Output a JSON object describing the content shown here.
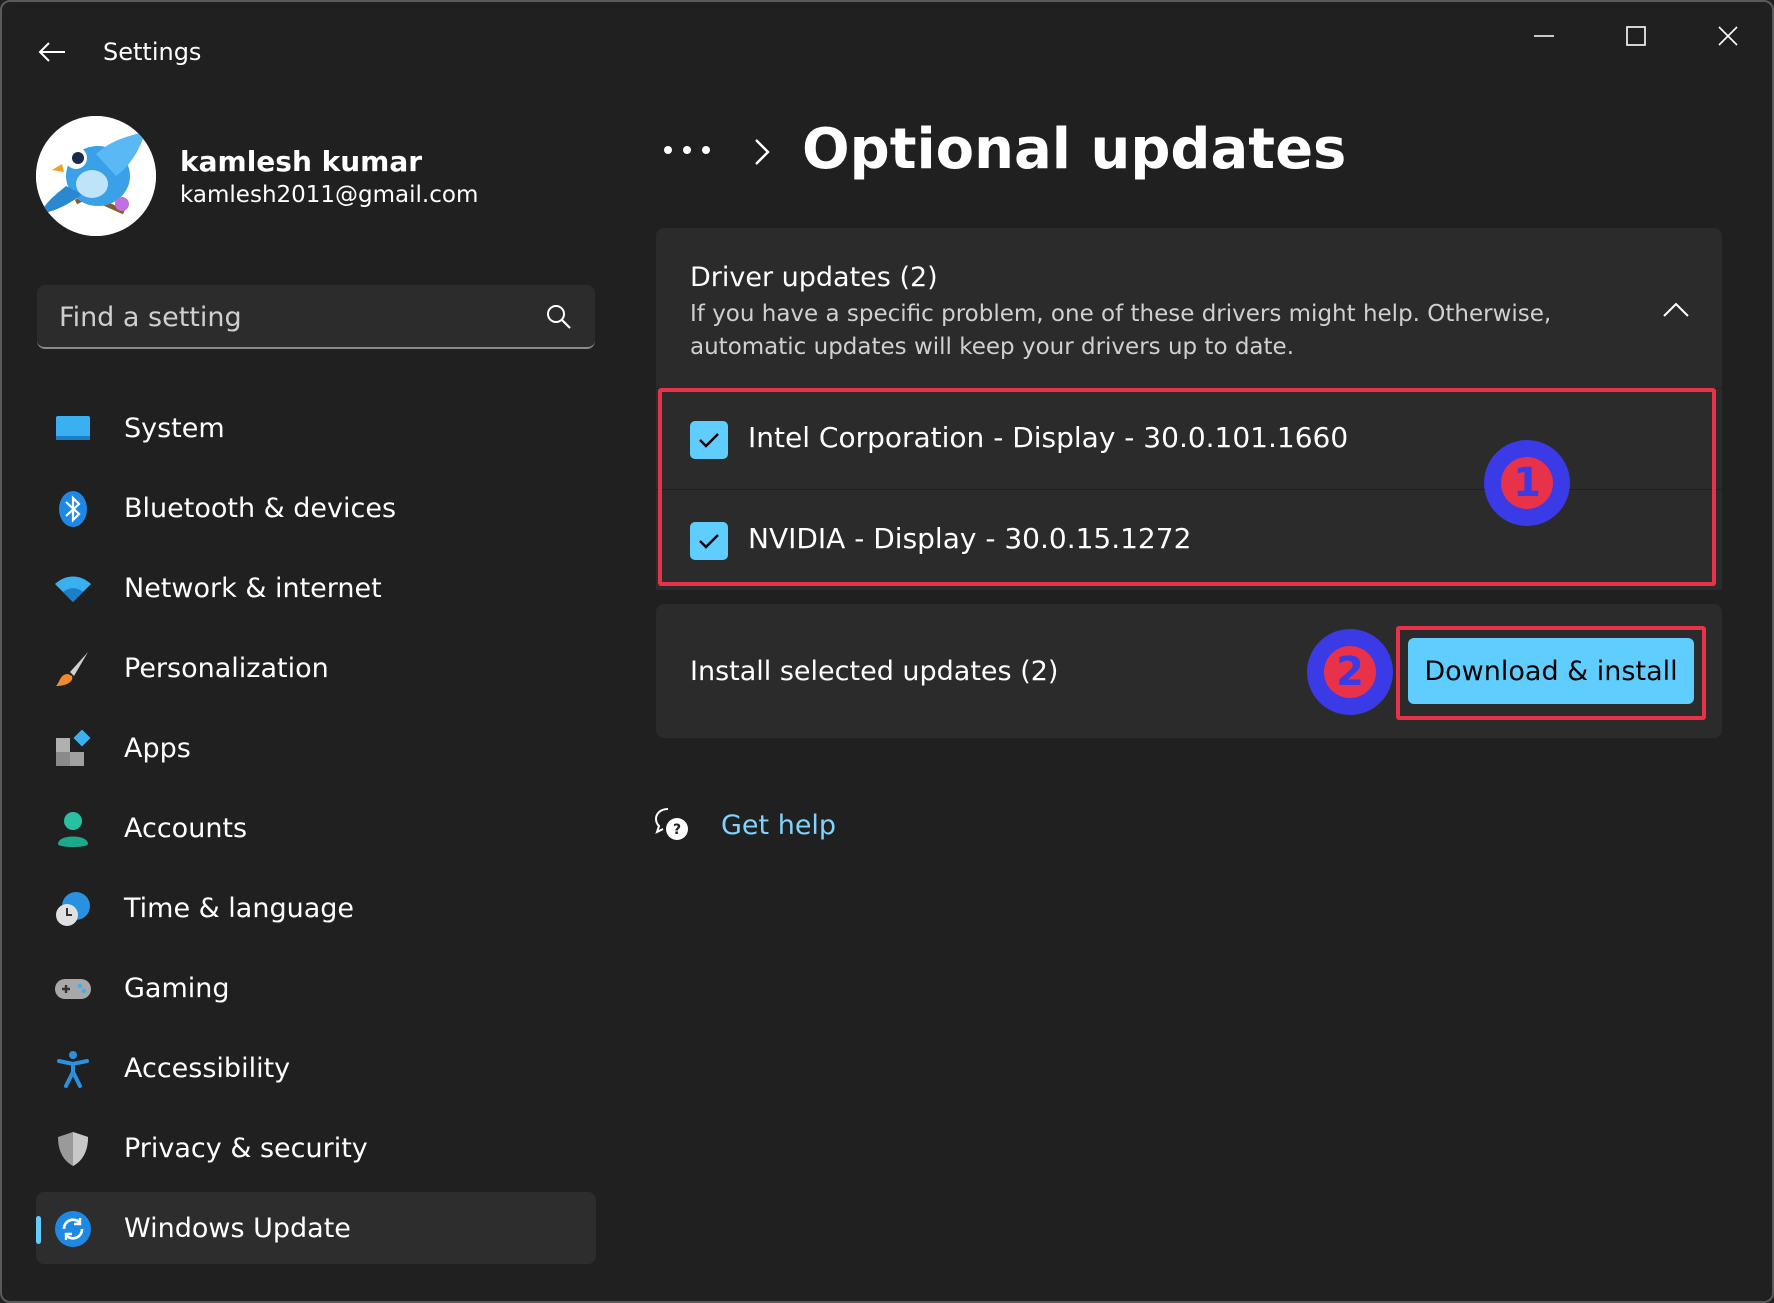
{
  "titlebar": {
    "app_title": "Settings",
    "controls": [
      "minimize-icon",
      "maximize-icon",
      "close-icon"
    ]
  },
  "profile": {
    "name": "kamlesh kumar",
    "email": "kamlesh2011@gmail.com"
  },
  "search": {
    "placeholder": "Find a setting",
    "value": ""
  },
  "sidebar": {
    "items": [
      {
        "label": "System",
        "icon": "monitor-icon"
      },
      {
        "label": "Bluetooth & devices",
        "icon": "bluetooth-icon"
      },
      {
        "label": "Network & internet",
        "icon": "wifi-icon"
      },
      {
        "label": "Personalization",
        "icon": "paintbrush-icon"
      },
      {
        "label": "Apps",
        "icon": "apps-icon"
      },
      {
        "label": "Accounts",
        "icon": "person-icon"
      },
      {
        "label": "Time & language",
        "icon": "globe-clock-icon"
      },
      {
        "label": "Gaming",
        "icon": "gamepad-icon"
      },
      {
        "label": "Accessibility",
        "icon": "accessibility-icon"
      },
      {
        "label": "Privacy & security",
        "icon": "shield-icon"
      },
      {
        "label": "Windows Update",
        "icon": "sync-icon",
        "active": true
      }
    ]
  },
  "main": {
    "title": "Optional updates",
    "driver_section": {
      "title": "Driver updates (2)",
      "description": "If you have a specific problem, one of these drivers might help. Otherwise, automatic updates will keep your drivers up to date.",
      "items": [
        {
          "label": "Intel Corporation - Display - 30.0.101.1660",
          "checked": true
        },
        {
          "label": "NVIDIA - Display - 30.0.15.1272",
          "checked": true
        }
      ]
    },
    "install_section": {
      "label": "Install selected updates (2)",
      "button_label": "Download & install"
    },
    "help": {
      "label": "Get help"
    }
  },
  "annotations": {
    "badge_1": "1",
    "badge_2": "2"
  },
  "colors": {
    "background": "#202020",
    "panel": "#2b2b2b",
    "accent": "#60cdff",
    "highlight": "#e8324a",
    "badge": "#3a3ae6",
    "link": "#7fd4ff"
  }
}
